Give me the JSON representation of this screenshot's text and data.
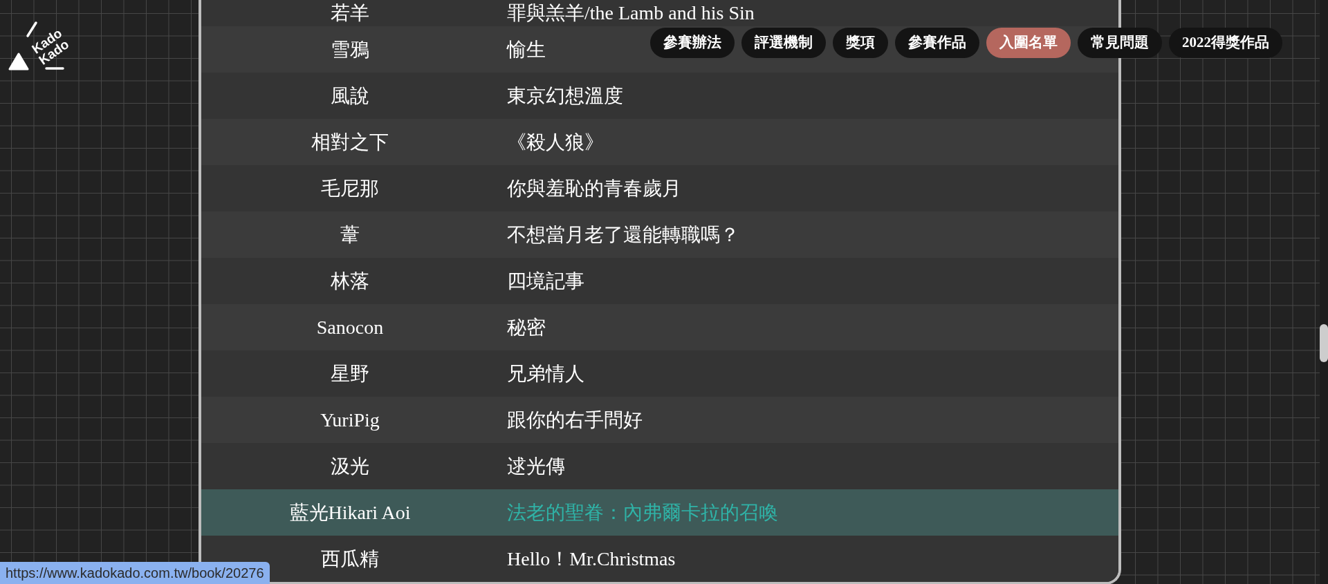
{
  "logo": {
    "lines": [
      "Kado",
      "Kado"
    ]
  },
  "nav": [
    {
      "label": "參賽辦法",
      "selected": false
    },
    {
      "label": "評選機制",
      "selected": false
    },
    {
      "label": "獎項",
      "selected": false
    },
    {
      "label": "參賽作品",
      "selected": false
    },
    {
      "label": "入圍名單",
      "selected": true
    },
    {
      "label": "常見問題",
      "selected": false
    },
    {
      "label": "2022得獎作品",
      "selected": false
    }
  ],
  "table": {
    "rows": [
      {
        "author": "若羊",
        "title": "罪與羔羊/the Lamb and his Sin",
        "highlighted": false
      },
      {
        "author": "雪鴉",
        "title": "愉生",
        "highlighted": false
      },
      {
        "author": "風說",
        "title": "東京幻想溫度",
        "highlighted": false
      },
      {
        "author": "相對之下",
        "title": "《殺人狼》",
        "highlighted": false
      },
      {
        "author": "毛尼那",
        "title": "你與羞恥的青春歲月",
        "highlighted": false
      },
      {
        "author": "葦",
        "title": "不想當月老了還能轉職嗎？",
        "highlighted": false
      },
      {
        "author": "林落",
        "title": "四境記事",
        "highlighted": false
      },
      {
        "author": "Sanocon",
        "title": "秘密",
        "highlighted": false
      },
      {
        "author": "星野",
        "title": "兄弟情人",
        "highlighted": false
      },
      {
        "author": "YuriPig",
        "title": "跟你的右手問好",
        "highlighted": false
      },
      {
        "author": "汲光",
        "title": "逑光傳",
        "highlighted": false
      },
      {
        "author": "藍光Hikari Aoi",
        "title": "法老的聖眷：內弗爾卡拉的召喚",
        "highlighted": true
      },
      {
        "author": "西瓜精",
        "title": "Hello！Mr.Christmas",
        "highlighted": false
      }
    ]
  },
  "status_bar": {
    "url": "https://www.kadokado.com.tw/book/20276"
  }
}
